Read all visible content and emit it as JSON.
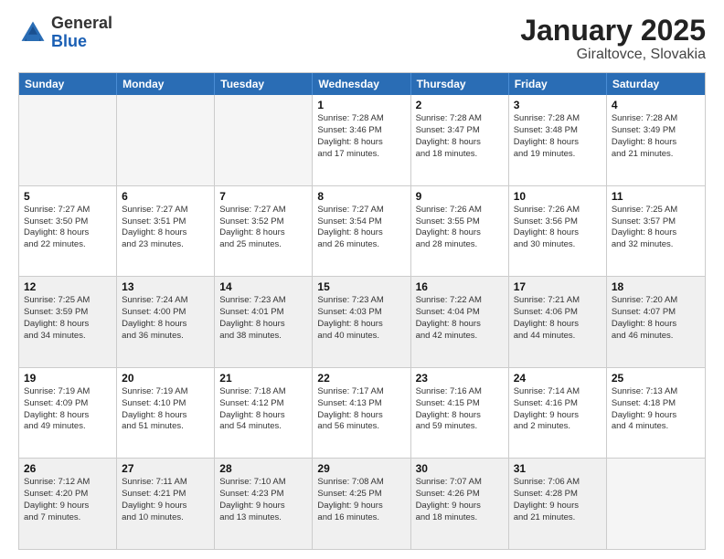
{
  "logo": {
    "general": "General",
    "blue": "Blue"
  },
  "title": "January 2025",
  "location": "Giraltovce, Slovakia",
  "header_days": [
    "Sunday",
    "Monday",
    "Tuesday",
    "Wednesday",
    "Thursday",
    "Friday",
    "Saturday"
  ],
  "weeks": [
    [
      {
        "day": "",
        "info": "",
        "empty": true
      },
      {
        "day": "",
        "info": "",
        "empty": true
      },
      {
        "day": "",
        "info": "",
        "empty": true
      },
      {
        "day": "1",
        "info": "Sunrise: 7:28 AM\nSunset: 3:46 PM\nDaylight: 8 hours\nand 17 minutes."
      },
      {
        "day": "2",
        "info": "Sunrise: 7:28 AM\nSunset: 3:47 PM\nDaylight: 8 hours\nand 18 minutes."
      },
      {
        "day": "3",
        "info": "Sunrise: 7:28 AM\nSunset: 3:48 PM\nDaylight: 8 hours\nand 19 minutes."
      },
      {
        "day": "4",
        "info": "Sunrise: 7:28 AM\nSunset: 3:49 PM\nDaylight: 8 hours\nand 21 minutes."
      }
    ],
    [
      {
        "day": "5",
        "info": "Sunrise: 7:27 AM\nSunset: 3:50 PM\nDaylight: 8 hours\nand 22 minutes."
      },
      {
        "day": "6",
        "info": "Sunrise: 7:27 AM\nSunset: 3:51 PM\nDaylight: 8 hours\nand 23 minutes."
      },
      {
        "day": "7",
        "info": "Sunrise: 7:27 AM\nSunset: 3:52 PM\nDaylight: 8 hours\nand 25 minutes."
      },
      {
        "day": "8",
        "info": "Sunrise: 7:27 AM\nSunset: 3:54 PM\nDaylight: 8 hours\nand 26 minutes."
      },
      {
        "day": "9",
        "info": "Sunrise: 7:26 AM\nSunset: 3:55 PM\nDaylight: 8 hours\nand 28 minutes."
      },
      {
        "day": "10",
        "info": "Sunrise: 7:26 AM\nSunset: 3:56 PM\nDaylight: 8 hours\nand 30 minutes."
      },
      {
        "day": "11",
        "info": "Sunrise: 7:25 AM\nSunset: 3:57 PM\nDaylight: 8 hours\nand 32 minutes."
      }
    ],
    [
      {
        "day": "12",
        "info": "Sunrise: 7:25 AM\nSunset: 3:59 PM\nDaylight: 8 hours\nand 34 minutes.",
        "shaded": true
      },
      {
        "day": "13",
        "info": "Sunrise: 7:24 AM\nSunset: 4:00 PM\nDaylight: 8 hours\nand 36 minutes.",
        "shaded": true
      },
      {
        "day": "14",
        "info": "Sunrise: 7:23 AM\nSunset: 4:01 PM\nDaylight: 8 hours\nand 38 minutes.",
        "shaded": true
      },
      {
        "day": "15",
        "info": "Sunrise: 7:23 AM\nSunset: 4:03 PM\nDaylight: 8 hours\nand 40 minutes.",
        "shaded": true
      },
      {
        "day": "16",
        "info": "Sunrise: 7:22 AM\nSunset: 4:04 PM\nDaylight: 8 hours\nand 42 minutes.",
        "shaded": true
      },
      {
        "day": "17",
        "info": "Sunrise: 7:21 AM\nSunset: 4:06 PM\nDaylight: 8 hours\nand 44 minutes.",
        "shaded": true
      },
      {
        "day": "18",
        "info": "Sunrise: 7:20 AM\nSunset: 4:07 PM\nDaylight: 8 hours\nand 46 minutes.",
        "shaded": true
      }
    ],
    [
      {
        "day": "19",
        "info": "Sunrise: 7:19 AM\nSunset: 4:09 PM\nDaylight: 8 hours\nand 49 minutes."
      },
      {
        "day": "20",
        "info": "Sunrise: 7:19 AM\nSunset: 4:10 PM\nDaylight: 8 hours\nand 51 minutes."
      },
      {
        "day": "21",
        "info": "Sunrise: 7:18 AM\nSunset: 4:12 PM\nDaylight: 8 hours\nand 54 minutes."
      },
      {
        "day": "22",
        "info": "Sunrise: 7:17 AM\nSunset: 4:13 PM\nDaylight: 8 hours\nand 56 minutes."
      },
      {
        "day": "23",
        "info": "Sunrise: 7:16 AM\nSunset: 4:15 PM\nDaylight: 8 hours\nand 59 minutes."
      },
      {
        "day": "24",
        "info": "Sunrise: 7:14 AM\nSunset: 4:16 PM\nDaylight: 9 hours\nand 2 minutes."
      },
      {
        "day": "25",
        "info": "Sunrise: 7:13 AM\nSunset: 4:18 PM\nDaylight: 9 hours\nand 4 minutes."
      }
    ],
    [
      {
        "day": "26",
        "info": "Sunrise: 7:12 AM\nSunset: 4:20 PM\nDaylight: 9 hours\nand 7 minutes.",
        "shaded": true
      },
      {
        "day": "27",
        "info": "Sunrise: 7:11 AM\nSunset: 4:21 PM\nDaylight: 9 hours\nand 10 minutes.",
        "shaded": true
      },
      {
        "day": "28",
        "info": "Sunrise: 7:10 AM\nSunset: 4:23 PM\nDaylight: 9 hours\nand 13 minutes.",
        "shaded": true
      },
      {
        "day": "29",
        "info": "Sunrise: 7:08 AM\nSunset: 4:25 PM\nDaylight: 9 hours\nand 16 minutes.",
        "shaded": true
      },
      {
        "day": "30",
        "info": "Sunrise: 7:07 AM\nSunset: 4:26 PM\nDaylight: 9 hours\nand 18 minutes.",
        "shaded": true
      },
      {
        "day": "31",
        "info": "Sunrise: 7:06 AM\nSunset: 4:28 PM\nDaylight: 9 hours\nand 21 minutes.",
        "shaded": true
      },
      {
        "day": "",
        "info": "",
        "empty": true,
        "shaded": true
      }
    ]
  ]
}
